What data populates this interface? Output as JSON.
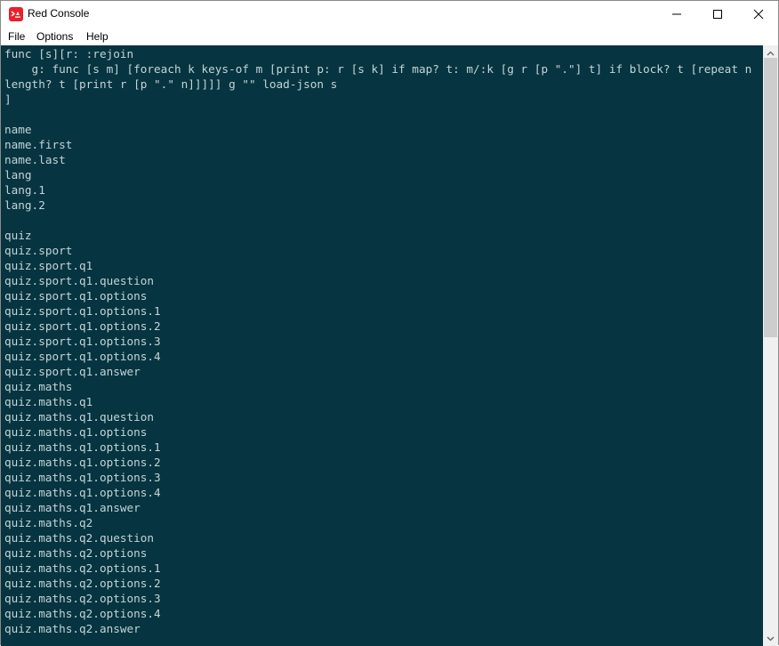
{
  "window": {
    "title": "Red Console",
    "icon": "red-console-icon",
    "controls": [
      "minimize",
      "maximize",
      "close"
    ]
  },
  "menu": {
    "items": [
      {
        "label": "File"
      },
      {
        "label": "Options"
      },
      {
        "label": "Help"
      }
    ]
  },
  "colors": {
    "console_bg": "#063440",
    "console_text": "#c3d5d9",
    "icon_red": "#e8212a"
  },
  "console": {
    "lines": [
      "func [s][r: :rejoin",
      "    g: func [s m] [foreach k keys-of m [print p: r [s k] if map? t: m/:k [g r [p \".\"] t] if block? t [repeat n",
      "length? t [print r [p \".\" n]]]]] g \"\" load-json s",
      "]",
      "",
      "name",
      "name.first",
      "name.last",
      "lang",
      "lang.1",
      "lang.2",
      "",
      "quiz",
      "quiz.sport",
      "quiz.sport.q1",
      "quiz.sport.q1.question",
      "quiz.sport.q1.options",
      "quiz.sport.q1.options.1",
      "quiz.sport.q1.options.2",
      "quiz.sport.q1.options.3",
      "quiz.sport.q1.options.4",
      "quiz.sport.q1.answer",
      "quiz.maths",
      "quiz.maths.q1",
      "quiz.maths.q1.question",
      "quiz.maths.q1.options",
      "quiz.maths.q1.options.1",
      "quiz.maths.q1.options.2",
      "quiz.maths.q1.options.3",
      "quiz.maths.q1.options.4",
      "quiz.maths.q1.answer",
      "quiz.maths.q2",
      "quiz.maths.q2.question",
      "quiz.maths.q2.options",
      "quiz.maths.q2.options.1",
      "quiz.maths.q2.options.2",
      "quiz.maths.q2.options.3",
      "quiz.maths.q2.options.4",
      "quiz.maths.q2.answer"
    ]
  },
  "scrollbar": {
    "position_fraction": 0.0,
    "visible_fraction": 0.49
  }
}
